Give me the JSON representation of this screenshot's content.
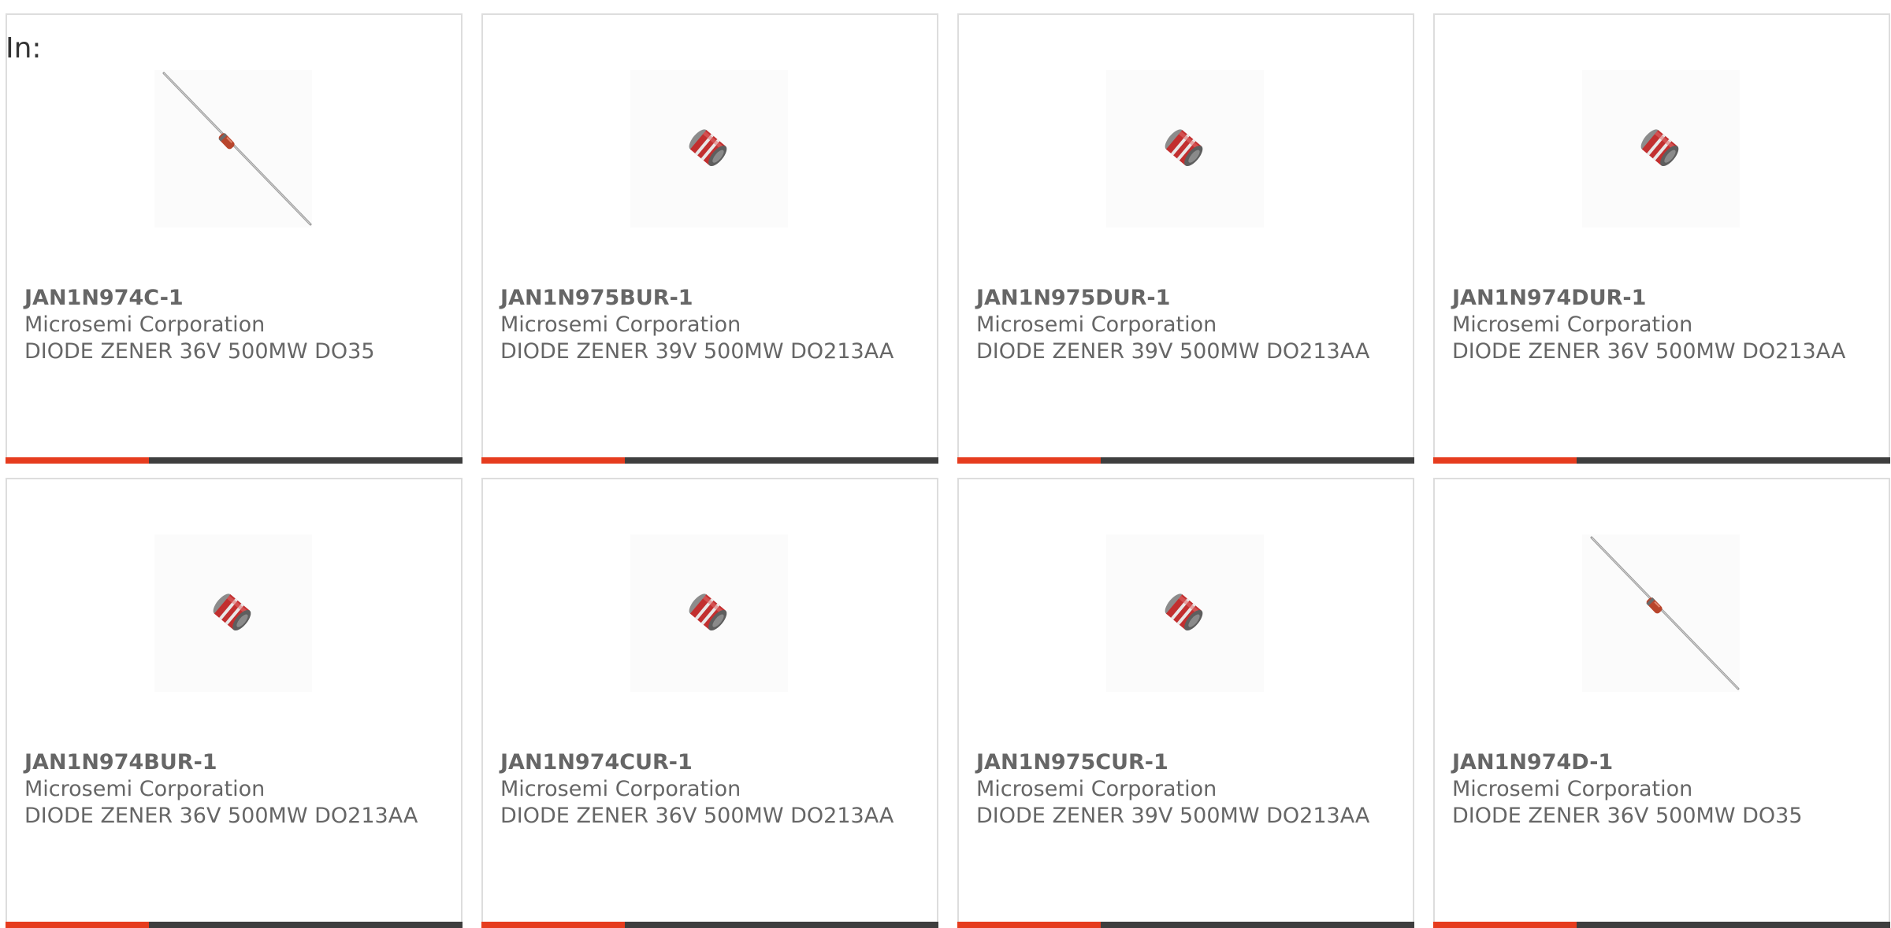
{
  "filter_label": "In:",
  "colors": {
    "accent": "#e63c1e",
    "bar": "#3e3e3e",
    "text": "#666666",
    "border": "#dddddd"
  },
  "products": [
    {
      "part_number": "JAN1N974C-1",
      "manufacturer": "Microsemi Corporation",
      "description": "DIODE ZENER 36V 500MW DO35",
      "image_icon": "axial-diode-icon"
    },
    {
      "part_number": "JAN1N975BUR-1",
      "manufacturer": "Microsemi Corporation",
      "description": "DIODE ZENER 39V 500MW DO213AA",
      "image_icon": "melf-diode-icon"
    },
    {
      "part_number": "JAN1N975DUR-1",
      "manufacturer": "Microsemi Corporation",
      "description": "DIODE ZENER 39V 500MW DO213AA",
      "image_icon": "melf-diode-icon"
    },
    {
      "part_number": "JAN1N974DUR-1",
      "manufacturer": "Microsemi Corporation",
      "description": "DIODE ZENER 36V 500MW DO213AA",
      "image_icon": "melf-diode-icon"
    },
    {
      "part_number": "JAN1N974BUR-1",
      "manufacturer": "Microsemi Corporation",
      "description": "DIODE ZENER 36V 500MW DO213AA",
      "image_icon": "melf-diode-icon"
    },
    {
      "part_number": "JAN1N974CUR-1",
      "manufacturer": "Microsemi Corporation",
      "description": "DIODE ZENER 36V 500MW DO213AA",
      "image_icon": "melf-diode-icon"
    },
    {
      "part_number": "JAN1N975CUR-1",
      "manufacturer": "Microsemi Corporation",
      "description": "DIODE ZENER 39V 500MW DO213AA",
      "image_icon": "melf-diode-icon"
    },
    {
      "part_number": "JAN1N974D-1",
      "manufacturer": "Microsemi Corporation",
      "description": "DIODE ZENER 36V 500MW DO35",
      "image_icon": "axial-diode-icon"
    }
  ]
}
